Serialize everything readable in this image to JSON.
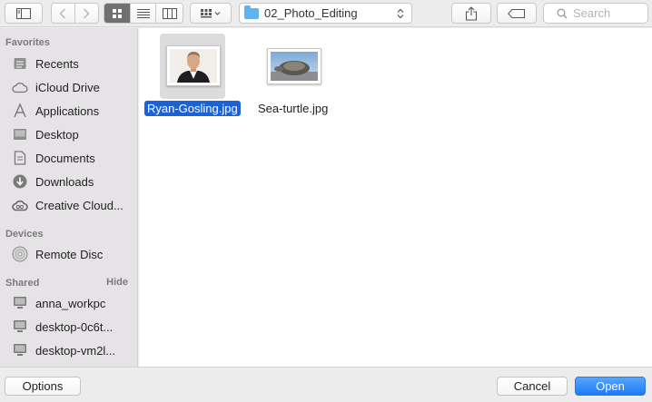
{
  "toolbar": {
    "path_label": "02_Photo_Editing",
    "search_placeholder": "Search"
  },
  "sidebar": {
    "favorites_heading": "Favorites",
    "favorites": [
      {
        "label": "Recents",
        "icon": "recents-icon"
      },
      {
        "label": "iCloud Drive",
        "icon": "cloud-icon"
      },
      {
        "label": "Applications",
        "icon": "applications-icon"
      },
      {
        "label": "Desktop",
        "icon": "desktop-icon"
      },
      {
        "label": "Documents",
        "icon": "documents-icon"
      },
      {
        "label": "Downloads",
        "icon": "downloads-icon"
      },
      {
        "label": "Creative Cloud...",
        "icon": "creative-cloud-icon"
      }
    ],
    "devices_heading": "Devices",
    "devices": [
      {
        "label": "Remote Disc",
        "icon": "disc-icon"
      }
    ],
    "shared_heading": "Shared",
    "shared_hide": "Hide",
    "shared": [
      {
        "label": "anna_workpc",
        "icon": "computer-icon"
      },
      {
        "label": "desktop-0c6t...",
        "icon": "computer-icon"
      },
      {
        "label": "desktop-vm2l...",
        "icon": "computer-icon"
      }
    ]
  },
  "files": [
    {
      "name": "Ryan-Gosling.jpg",
      "selected": true
    },
    {
      "name": "Sea-turtle.jpg",
      "selected": false
    }
  ],
  "bottom": {
    "options_label": "Options",
    "cancel_label": "Cancel",
    "open_label": "Open"
  }
}
